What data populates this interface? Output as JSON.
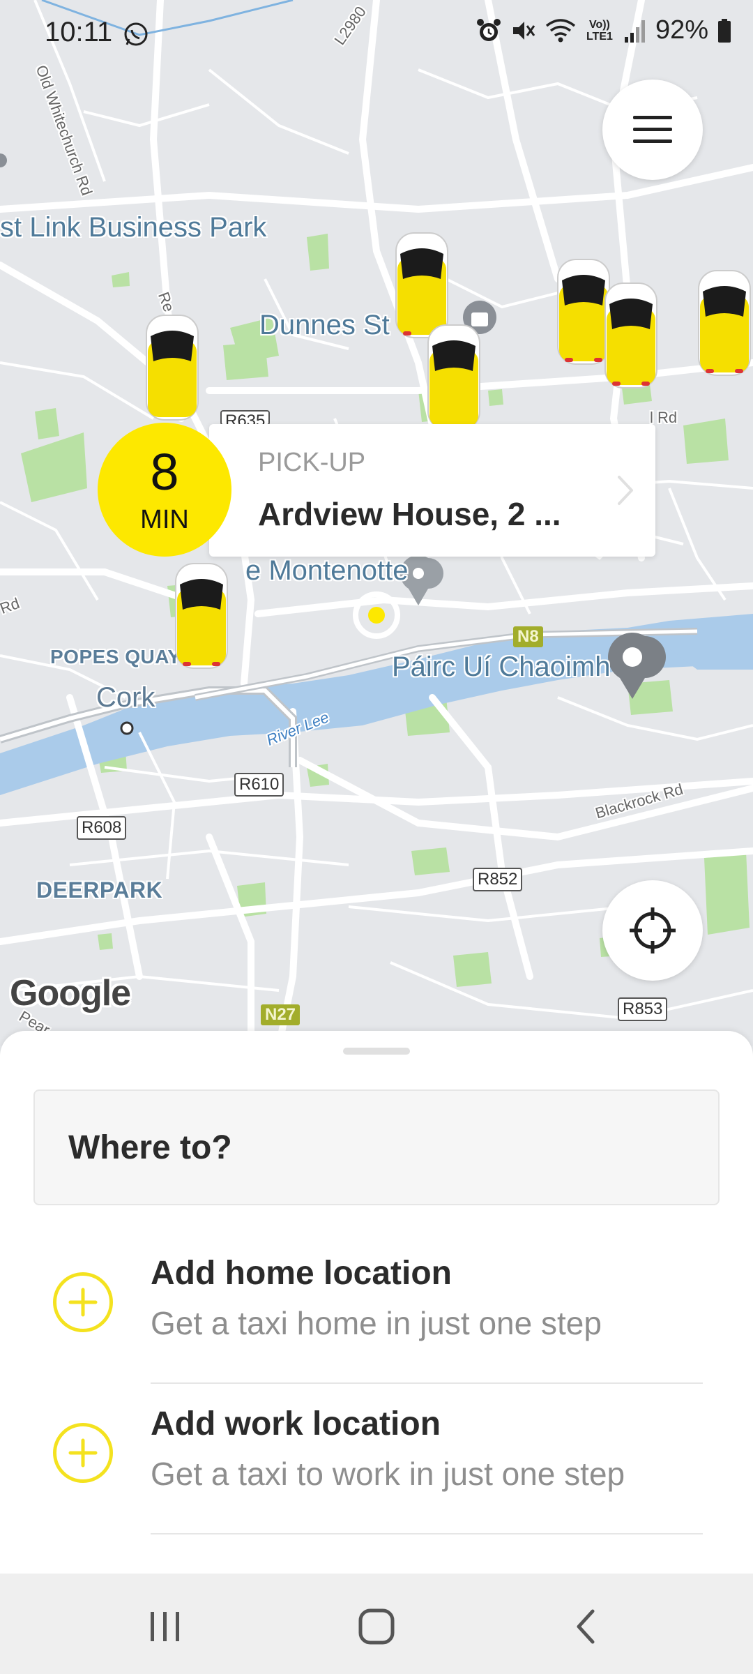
{
  "status_bar": {
    "time": "10:11",
    "battery": "92%",
    "network_label": "Vo)) LTE1",
    "icons": [
      "whatsapp-icon",
      "alarm-icon",
      "mute-icon",
      "wifi-icon",
      "signal-icon",
      "battery-icon"
    ]
  },
  "map": {
    "labels": {
      "business_park": "st Link Business Park",
      "dunnes": "Dunnes St",
      "montenotte": "e Montenotte",
      "pairc": "Páirc Uí Chaoimh",
      "popes_quay": "POPES QUAY",
      "cork": "Cork",
      "river_lee": "River Lee",
      "deerpark": "DEERPARK",
      "blackrock": "Blackrock Rd",
      "whitechurch": "Old Whitechurch Rd",
      "l2980": "L2980",
      "rd_fragment": "l Rd",
      "re_fragment": "Re",
      "rd_left": "Rd",
      "pearse": "Pear"
    },
    "shields": {
      "r610": "R610",
      "r608": "R608",
      "r852": "R852",
      "r853": "R853",
      "r635": "R635",
      "n8": "N8",
      "n27": "N27"
    },
    "attribution": "Google"
  },
  "menu_button": {
    "icon": "hamburger-menu-icon"
  },
  "locate_button": {
    "icon": "crosshair-icon"
  },
  "eta": {
    "value": "8",
    "unit": "MIN"
  },
  "pickup": {
    "label": "PICK-UP",
    "address": "Ardview House, 2 ...",
    "icon": "chevron-right-icon"
  },
  "sheet": {
    "where_to": "Where to?",
    "shortcuts": [
      {
        "title": "Add home location",
        "subtitle": "Get a taxi home in just one step",
        "icon": "plus-circle-icon"
      },
      {
        "title": "Add work location",
        "subtitle": "Get a taxi to work in just one step",
        "icon": "plus-circle-icon"
      }
    ]
  },
  "navbar": {
    "buttons": [
      "recents-icon",
      "home-icon",
      "back-icon"
    ]
  },
  "colors": {
    "accent_yellow": "#fde800",
    "map_bg": "#e5e7ea",
    "water": "#aacbea",
    "park": "#b9e1a4"
  }
}
